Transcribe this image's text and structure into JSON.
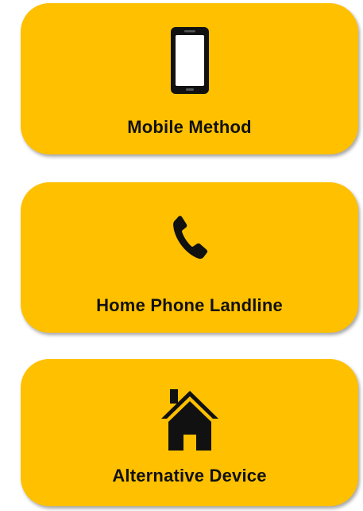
{
  "options": [
    {
      "id": "mobile",
      "label": "Mobile Method",
      "icon": "mobile-phone-icon"
    },
    {
      "id": "landline",
      "label": "Home Phone Landline",
      "icon": "telephone-handset-icon"
    },
    {
      "id": "alternative",
      "label": "Alternative Device",
      "icon": "house-icon"
    }
  ],
  "colors": {
    "card_background": "#ffc000",
    "icon": "#111111",
    "text": "#111111"
  }
}
